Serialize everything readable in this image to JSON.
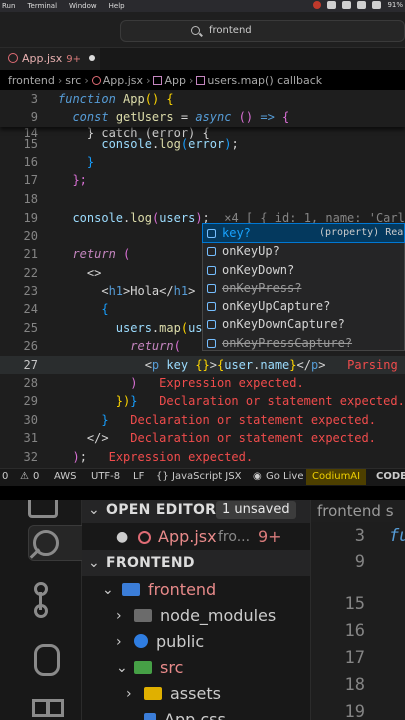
{
  "menubar": {
    "items": [
      "Run",
      "Terminal",
      "Window",
      "Help"
    ],
    "battery": "91%"
  },
  "titlebar": {
    "search_text": "frontend"
  },
  "tab": {
    "filename": "App.jsx",
    "problems": "9+"
  },
  "breadcrumb": [
    "frontend",
    "src",
    "App.jsx",
    "App",
    "users.map() callback"
  ],
  "editor": {
    "sticky": [
      {
        "num": "3",
        "text": "function App() {"
      },
      {
        "num": "9",
        "text": "  const getUsers = async () => {"
      }
    ],
    "lines": [
      {
        "num": "14",
        "text": "    } catch (error) {"
      },
      {
        "num": "15",
        "text": "      console.log(error);"
      },
      {
        "num": "16",
        "text": "    }"
      },
      {
        "num": "17",
        "text": "  };"
      },
      {
        "num": "18",
        "text": ""
      },
      {
        "num": "19",
        "text": "  console.log(users);",
        "hint": "  ×4 [ { id: 1, name: 'Carl"
      },
      {
        "num": "20",
        "text": ""
      },
      {
        "num": "21",
        "text": "  return ("
      },
      {
        "num": "22",
        "text": "    <>"
      },
      {
        "num": "23",
        "text": "      <h1>Hola</h1>"
      },
      {
        "num": "24",
        "text": "      {"
      },
      {
        "num": "25",
        "text": "        users.map(us"
      },
      {
        "num": "26",
        "text": "          return("
      },
      {
        "num": "27",
        "text": "            <p key {}>{user.name}</p>",
        "error": "Parsing"
      },
      {
        "num": "28",
        "text": "          )",
        "error": "Expression expected."
      },
      {
        "num": "29",
        "text": "        })}",
        "error": "Declaration or statement expected."
      },
      {
        "num": "30",
        "text": "      }",
        "error": "Declaration or statement expected."
      },
      {
        "num": "31",
        "text": "    </>",
        "error": "Declaration or statement expected."
      },
      {
        "num": "32",
        "text": "  );",
        "error": "Expression expected."
      }
    ]
  },
  "suggest": {
    "items": [
      {
        "label": "key?",
        "detail": "(property) Rea",
        "selected": true,
        "deprecated": false
      },
      {
        "label": "onKeyUp?",
        "detail": "",
        "selected": false,
        "deprecated": false
      },
      {
        "label": "onKeyDown?",
        "detail": "",
        "selected": false,
        "deprecated": false
      },
      {
        "label": "onKeyPress?",
        "detail": "",
        "selected": false,
        "deprecated": true
      },
      {
        "label": "onKeyUpCapture?",
        "detail": "",
        "selected": false,
        "deprecated": false
      },
      {
        "label": "onKeyDownCapture?",
        "detail": "",
        "selected": false,
        "deprecated": false
      },
      {
        "label": "onKeyPressCapture?",
        "detail": "",
        "selected": false,
        "deprecated": true
      }
    ]
  },
  "statusbar": {
    "errors": "0",
    "warnings": "0",
    "aws": "AWS",
    "encoding": "UTF-8",
    "eol": "LF",
    "language": "JavaScript JSX",
    "golive": "Go Live",
    "codium": "CodiumAI",
    "codeium": "CODE"
  },
  "explorer": {
    "open_editors_title": "OPEN EDITORS",
    "unsaved_badge": "1 unsaved",
    "open_file": "App.jsx",
    "open_file_dir": "fro...",
    "open_file_problems": "9+",
    "workspace_title": "FRONTEND",
    "tree": [
      {
        "label": "frontend",
        "kind": "folder-blue",
        "depth": 1,
        "open": true
      },
      {
        "label": "node_modules",
        "kind": "folder-gray",
        "depth": 2,
        "open": false
      },
      {
        "label": "public",
        "kind": "globe",
        "depth": 2,
        "open": false
      },
      {
        "label": "src",
        "kind": "folder-green",
        "depth": 2,
        "open": true
      },
      {
        "label": "assets",
        "kind": "folder-yellow",
        "depth": 3,
        "open": false
      },
      {
        "label": "App.css",
        "kind": "file",
        "depth": 3,
        "open": false
      }
    ]
  },
  "editor2": {
    "tab_text": "frontend  s",
    "lines": [
      {
        "num": "3",
        "text": "fu"
      },
      {
        "num": "9",
        "text": ""
      },
      {
        "num": "15",
        "text": ""
      },
      {
        "num": "16",
        "text": ""
      },
      {
        "num": "17",
        "text": ""
      },
      {
        "num": "18",
        "text": ""
      },
      {
        "num": "19",
        "text": ""
      }
    ]
  },
  "colors": {
    "keyword": "#569cd6",
    "function": "#dcdcaa",
    "variable": "#9cdcfe",
    "error": "#f14c4c",
    "suggest_selected": "#04395e"
  }
}
